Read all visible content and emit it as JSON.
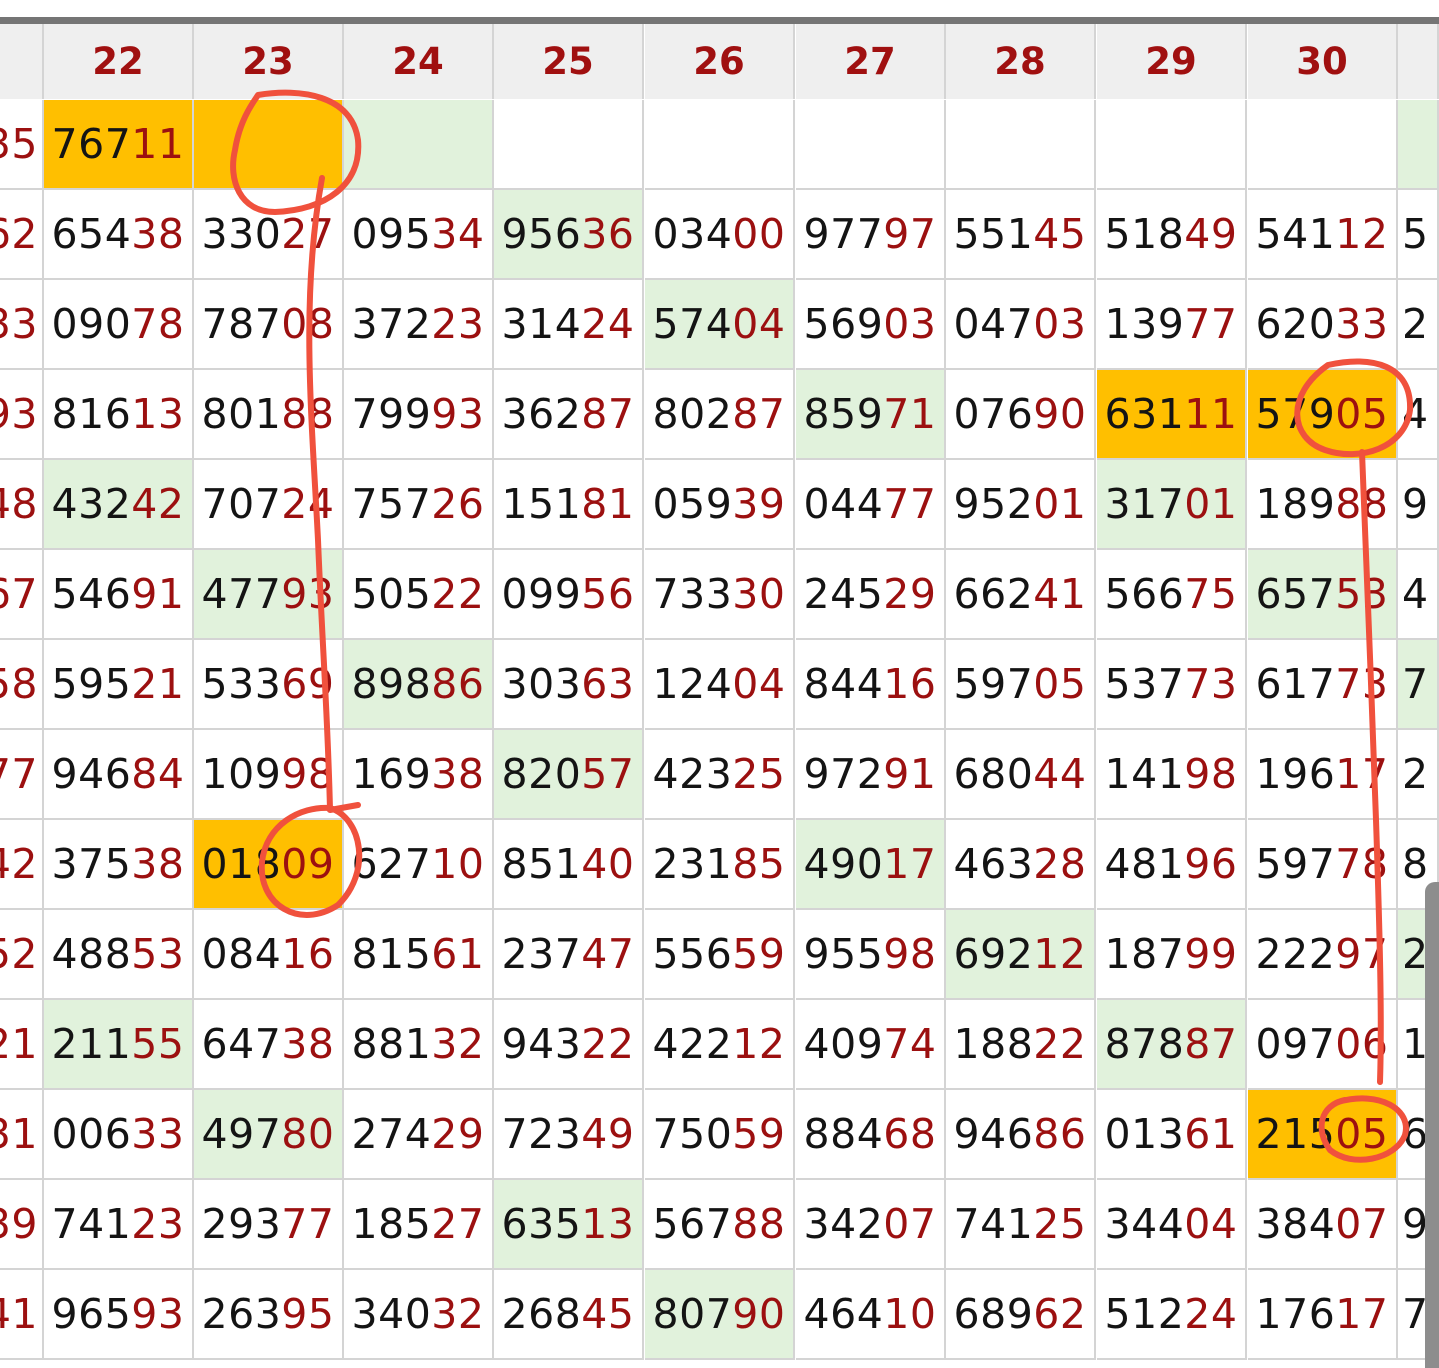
{
  "headers": [
    "22",
    "23",
    "24",
    "25",
    "26",
    "27",
    "28",
    "29",
    "30"
  ],
  "left_edge": [
    "35",
    "62",
    "33",
    "93",
    "48",
    "67",
    "58",
    "77",
    "42",
    "52",
    "21",
    "31",
    "39",
    "41"
  ],
  "right_edge": [
    "",
    "5",
    "2",
    "4",
    "9",
    "4",
    "7",
    "2",
    "8",
    "2",
    "1",
    "6",
    "9",
    "7"
  ],
  "rows": [
    [
      {
        "v": "76711",
        "s": "orange"
      },
      {
        "v": "",
        "s": "orange"
      },
      {
        "v": "",
        "s": "green"
      },
      {
        "v": "",
        "s": ""
      },
      {
        "v": "",
        "s": ""
      },
      {
        "v": "",
        "s": ""
      },
      {
        "v": "",
        "s": ""
      },
      {
        "v": "",
        "s": ""
      },
      {
        "v": "",
        "s": ""
      }
    ],
    [
      {
        "v": "65438",
        "s": ""
      },
      {
        "v": "33027",
        "s": ""
      },
      {
        "v": "09534",
        "s": ""
      },
      {
        "v": "95636",
        "s": "green"
      },
      {
        "v": "03400",
        "s": ""
      },
      {
        "v": "97797",
        "s": ""
      },
      {
        "v": "55145",
        "s": ""
      },
      {
        "v": "51849",
        "s": ""
      },
      {
        "v": "54112",
        "s": ""
      }
    ],
    [
      {
        "v": "09078",
        "s": ""
      },
      {
        "v": "78708",
        "s": ""
      },
      {
        "v": "37223",
        "s": ""
      },
      {
        "v": "31424",
        "s": ""
      },
      {
        "v": "57404",
        "s": "green"
      },
      {
        "v": "56903",
        "s": ""
      },
      {
        "v": "04703",
        "s": ""
      },
      {
        "v": "13977",
        "s": ""
      },
      {
        "v": "62033",
        "s": ""
      }
    ],
    [
      {
        "v": "81613",
        "s": ""
      },
      {
        "v": "80188",
        "s": ""
      },
      {
        "v": "79993",
        "s": ""
      },
      {
        "v": "36287",
        "s": ""
      },
      {
        "v": "80287",
        "s": ""
      },
      {
        "v": "85971",
        "s": "green"
      },
      {
        "v": "07690",
        "s": ""
      },
      {
        "v": "63111",
        "s": "orange"
      },
      {
        "v": "57905",
        "s": "orange"
      }
    ],
    [
      {
        "v": "43242",
        "s": "green"
      },
      {
        "v": "70724",
        "s": ""
      },
      {
        "v": "75726",
        "s": ""
      },
      {
        "v": "15181",
        "s": ""
      },
      {
        "v": "05939",
        "s": ""
      },
      {
        "v": "04477",
        "s": ""
      },
      {
        "v": "95201",
        "s": ""
      },
      {
        "v": "31701",
        "s": "green"
      },
      {
        "v": "18988",
        "s": ""
      }
    ],
    [
      {
        "v": "54691",
        "s": ""
      },
      {
        "v": "47793",
        "s": "green"
      },
      {
        "v": "50522",
        "s": ""
      },
      {
        "v": "09956",
        "s": ""
      },
      {
        "v": "73330",
        "s": ""
      },
      {
        "v": "24529",
        "s": ""
      },
      {
        "v": "66241",
        "s": ""
      },
      {
        "v": "56675",
        "s": ""
      },
      {
        "v": "65753",
        "s": "green"
      }
    ],
    [
      {
        "v": "59521",
        "s": ""
      },
      {
        "v": "53369",
        "s": ""
      },
      {
        "v": "89886",
        "s": "green"
      },
      {
        "v": "30363",
        "s": ""
      },
      {
        "v": "12404",
        "s": ""
      },
      {
        "v": "84416",
        "s": ""
      },
      {
        "v": "59705",
        "s": ""
      },
      {
        "v": "53773",
        "s": ""
      },
      {
        "v": "61773",
        "s": ""
      }
    ],
    [
      {
        "v": "94684",
        "s": ""
      },
      {
        "v": "10998",
        "s": ""
      },
      {
        "v": "16938",
        "s": ""
      },
      {
        "v": "82057",
        "s": "green"
      },
      {
        "v": "42325",
        "s": ""
      },
      {
        "v": "97291",
        "s": ""
      },
      {
        "v": "68044",
        "s": ""
      },
      {
        "v": "14198",
        "s": ""
      },
      {
        "v": "19617",
        "s": ""
      }
    ],
    [
      {
        "v": "37538",
        "s": ""
      },
      {
        "v": "01809",
        "s": "orange"
      },
      {
        "v": "62710",
        "s": ""
      },
      {
        "v": "85140",
        "s": ""
      },
      {
        "v": "23185",
        "s": ""
      },
      {
        "v": "49017",
        "s": "green"
      },
      {
        "v": "46328",
        "s": ""
      },
      {
        "v": "48196",
        "s": ""
      },
      {
        "v": "59778",
        "s": ""
      }
    ],
    [
      {
        "v": "48853",
        "s": ""
      },
      {
        "v": "08416",
        "s": ""
      },
      {
        "v": "81561",
        "s": ""
      },
      {
        "v": "23747",
        "s": ""
      },
      {
        "v": "55659",
        "s": ""
      },
      {
        "v": "95598",
        "s": ""
      },
      {
        "v": "69212",
        "s": "green"
      },
      {
        "v": "18799",
        "s": ""
      },
      {
        "v": "22297",
        "s": ""
      }
    ],
    [
      {
        "v": "21155",
        "s": "green"
      },
      {
        "v": "64738",
        "s": ""
      },
      {
        "v": "88132",
        "s": ""
      },
      {
        "v": "94322",
        "s": ""
      },
      {
        "v": "42212",
        "s": ""
      },
      {
        "v": "40974",
        "s": ""
      },
      {
        "v": "18822",
        "s": ""
      },
      {
        "v": "87887",
        "s": "green"
      },
      {
        "v": "09706",
        "s": ""
      }
    ],
    [
      {
        "v": "00633",
        "s": ""
      },
      {
        "v": "49780",
        "s": "green"
      },
      {
        "v": "27429",
        "s": ""
      },
      {
        "v": "72349",
        "s": ""
      },
      {
        "v": "75059",
        "s": ""
      },
      {
        "v": "88468",
        "s": ""
      },
      {
        "v": "94686",
        "s": ""
      },
      {
        "v": "01361",
        "s": ""
      },
      {
        "v": "21505",
        "s": "orange"
      }
    ],
    [
      {
        "v": "74123",
        "s": ""
      },
      {
        "v": "29377",
        "s": ""
      },
      {
        "v": "18527",
        "s": ""
      },
      {
        "v": "63513",
        "s": "green"
      },
      {
        "v": "56788",
        "s": ""
      },
      {
        "v": "34207",
        "s": ""
      },
      {
        "v": "74125",
        "s": ""
      },
      {
        "v": "34404",
        "s": ""
      },
      {
        "v": "38407",
        "s": ""
      }
    ],
    [
      {
        "v": "96593",
        "s": ""
      },
      {
        "v": "26395",
        "s": ""
      },
      {
        "v": "34032",
        "s": ""
      },
      {
        "v": "26845",
        "s": ""
      },
      {
        "v": "80790",
        "s": "green"
      },
      {
        "v": "46410",
        "s": ""
      },
      {
        "v": "68962",
        "s": ""
      },
      {
        "v": "51224",
        "s": ""
      },
      {
        "v": "17617",
        "s": ""
      }
    ]
  ],
  "colors": {
    "accent": "#9c1010",
    "highlight_orange": "#ffbf00",
    "highlight_green": "#e1f2dc",
    "annotation": "#f0513d"
  }
}
